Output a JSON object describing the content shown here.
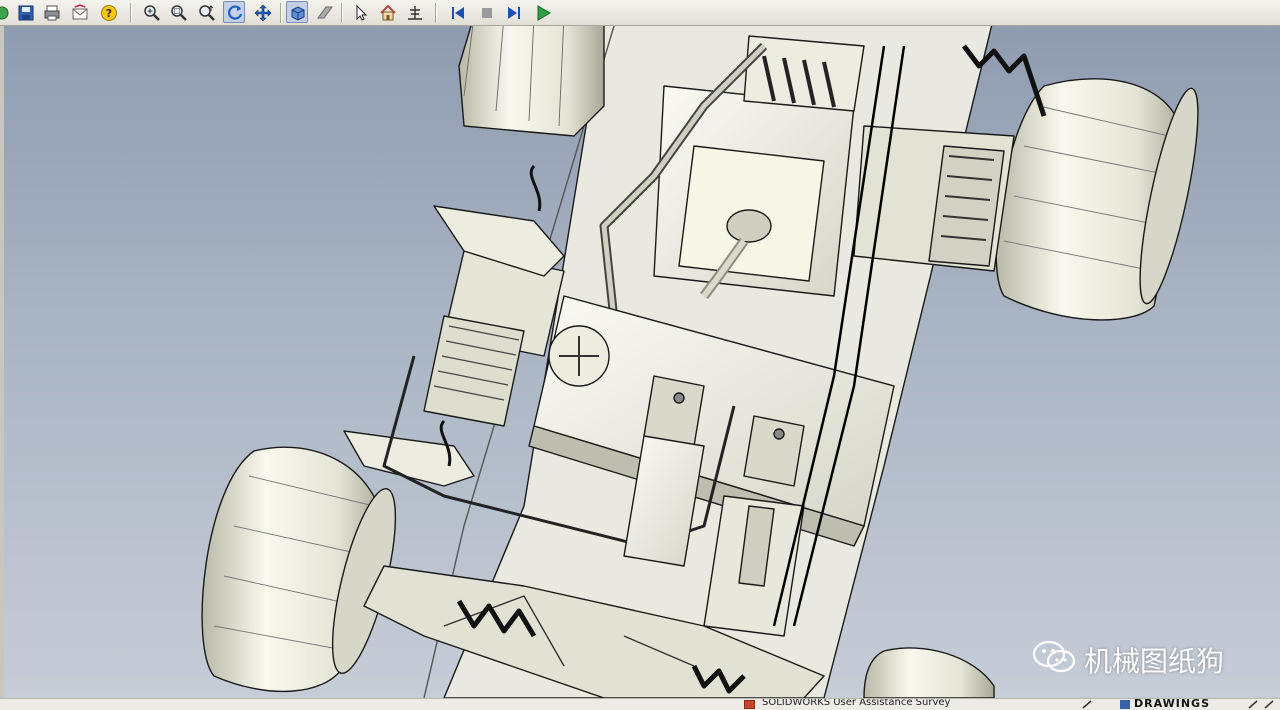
{
  "toolbar": {
    "buttons": [
      {
        "icon": "open-icon"
      },
      {
        "icon": "save-icon"
      },
      {
        "icon": "print-icon"
      },
      {
        "icon": "email-icon"
      },
      {
        "icon": "help-icon"
      },
      {
        "icon": "zoom-to-fit-icon"
      },
      {
        "icon": "zoom-to-area-icon"
      },
      {
        "icon": "zoom-in-out-icon"
      },
      {
        "icon": "rotate-icon"
      },
      {
        "icon": "pan-icon"
      },
      {
        "icon": "shaded-view-icon"
      },
      {
        "icon": "section-view-icon"
      },
      {
        "icon": "select-icon"
      },
      {
        "icon": "home-view-icon"
      },
      {
        "icon": "measure-icon"
      },
      {
        "icon": "first-frame-icon"
      },
      {
        "icon": "stop-icon"
      },
      {
        "icon": "next-frame-icon"
      },
      {
        "icon": "play-icon"
      }
    ],
    "active_tool": "rotate-icon"
  },
  "viewport": {
    "content": "rc-car-chassis-model",
    "colors": {
      "background_top": "#8f9cb0",
      "background_bottom": "#c5cdd7",
      "model_fill": "#f2f2ea",
      "model_shadow": "#c9c9bd",
      "model_edge": "#1a1a1a"
    }
  },
  "watermark": {
    "text": "机械图纸狗",
    "icon": "wechat-logo-icon"
  },
  "statusbar": {
    "task_label": "SOLIDWORKS User Assistance Survey",
    "drawings_label": "DRAWINGS"
  }
}
